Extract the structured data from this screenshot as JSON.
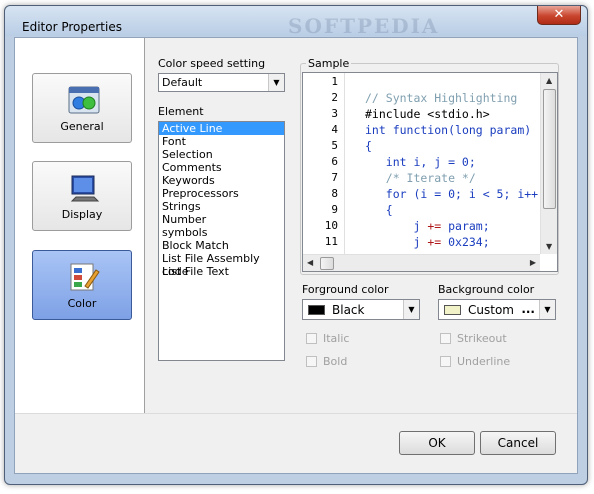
{
  "window": {
    "title": "Editor Properties",
    "watermark": "SOFTPEDIA",
    "close_glyph": "✕"
  },
  "nav": [
    {
      "label": "General",
      "icon": "general-settings-icon",
      "selected": false
    },
    {
      "label": "Display",
      "icon": "monitor-icon",
      "selected": false
    },
    {
      "label": "Color",
      "icon": "color-palette-icon",
      "selected": true
    }
  ],
  "color_speed": {
    "label": "Color speed setting",
    "value": "Default"
  },
  "element": {
    "label": "Element",
    "items": [
      "Active Line",
      "Font",
      "Selection",
      "Comments",
      "Keywords",
      "Preprocessors",
      "Strings",
      "Number",
      "symbols",
      "Block Match",
      "List File Assembly code",
      "List File Text"
    ],
    "selected_index": 0
  },
  "sample": {
    "label": "Sample",
    "line_numbers": [
      "1",
      "2",
      "3",
      "4",
      "5",
      "6",
      "7",
      "8",
      "9",
      "10",
      "11"
    ],
    "code": [
      [],
      [
        {
          "t": "// Syntax Highlighting",
          "c": "#7f9fb0"
        }
      ],
      [
        {
          "t": "#include <stdio.h>",
          "c": "#000"
        }
      ],
      [
        {
          "t": "int function",
          "c": "#1a3dbf"
        },
        {
          "t": "(long param)",
          "c": "#1a3dbf"
        }
      ],
      [
        {
          "t": "{",
          "c": "#1a3dbf"
        }
      ],
      [
        {
          "t": "   int ",
          "c": "#1a3dbf"
        },
        {
          "t": "i, j = 0;",
          "c": "#1a3dbf"
        }
      ],
      [
        {
          "t": "   /* Iterate */",
          "c": "#7f9fb0"
        }
      ],
      [
        {
          "t": "   for ",
          "c": "#1a3dbf"
        },
        {
          "t": "(i = 0; i < 5; i++)",
          "c": "#1a3dbf"
        }
      ],
      [
        {
          "t": "   {",
          "c": "#1a3dbf"
        }
      ],
      [
        {
          "t": "       j ",
          "c": "#1a3dbf"
        },
        {
          "t": "+= ",
          "c": "#b01a1a"
        },
        {
          "t": "param;",
          "c": "#1a3dbf"
        }
      ],
      [
        {
          "t": "       j ",
          "c": "#1a3dbf"
        },
        {
          "t": "+= ",
          "c": "#b01a1a"
        },
        {
          "t": "0x234;",
          "c": "#1a3dbf"
        }
      ]
    ]
  },
  "foreground": {
    "label": "Forground color",
    "value": "Black",
    "swatch": "#000000"
  },
  "background": {
    "label": "Background color",
    "value": "Custom",
    "swatch": "#f2f2c8",
    "more": "..."
  },
  "styles": {
    "italic": "Italic",
    "bold": "Bold",
    "strikeout": "Strikeout",
    "underline": "Underline"
  },
  "buttons": {
    "ok": "OK",
    "cancel": "Cancel"
  }
}
